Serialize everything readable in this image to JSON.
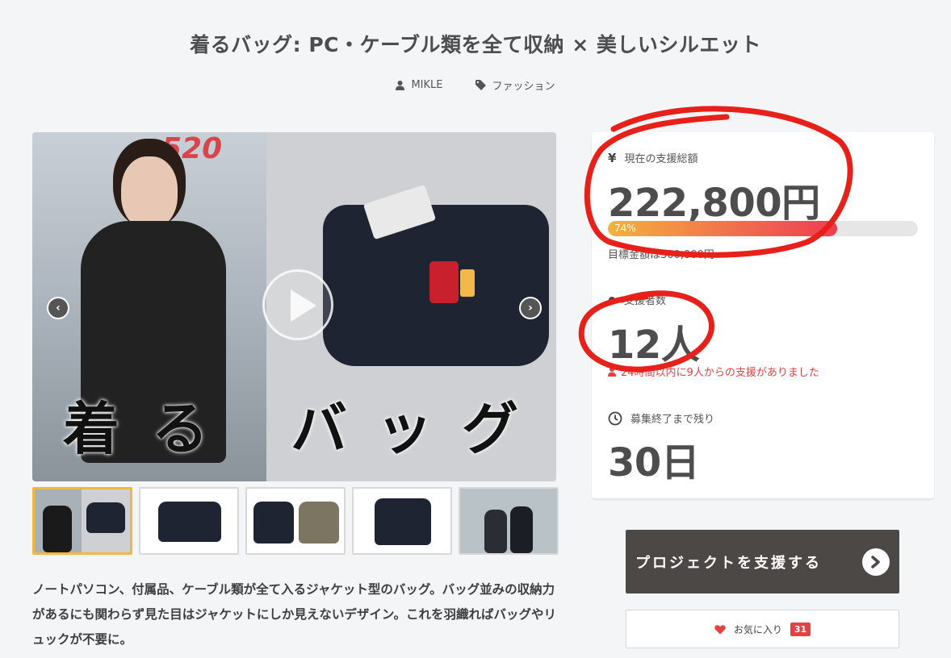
{
  "page": {
    "title": "着るバッグ: PC・ケーブル類を全て収納 × 美しいシルエット",
    "author": "MIKLE",
    "category": "ファッション"
  },
  "media": {
    "hero_text_left": "着る",
    "hero_text_right": "バッグ",
    "sign_text": "520",
    "thumbnail_count": 5
  },
  "description": "ノートパソコン、付属品、ケーブル類が全て入るジャケット型のバッグ。バッグ並みの収納力があるにも関わらず見た目はジャケットにしか見えないデザイン。これを羽織ればバッグやリュックが不要に。",
  "stats": {
    "currency_icon": "¥",
    "raised_label": "現在の支援総額",
    "raised_value": "222,800円",
    "progress_text": "74%",
    "progress_fraction": 0.74,
    "target_text": "目標金額は300,000円",
    "backers_label": "支援者数",
    "backers_value": "12人",
    "recent_text": "24時間以内に9人からの支援がありました",
    "remaining_label": "募集終了まで残り",
    "remaining_value": "30日"
  },
  "actions": {
    "back_button": "プロジェクトを支援する",
    "favorite_label": "お気に入り",
    "favorite_count": "31"
  },
  "colors": {
    "annotation_red": "#e8201a",
    "button_dark": "#4b4846",
    "accent_red": "#e34242",
    "thumb_active": "#f0b840"
  }
}
